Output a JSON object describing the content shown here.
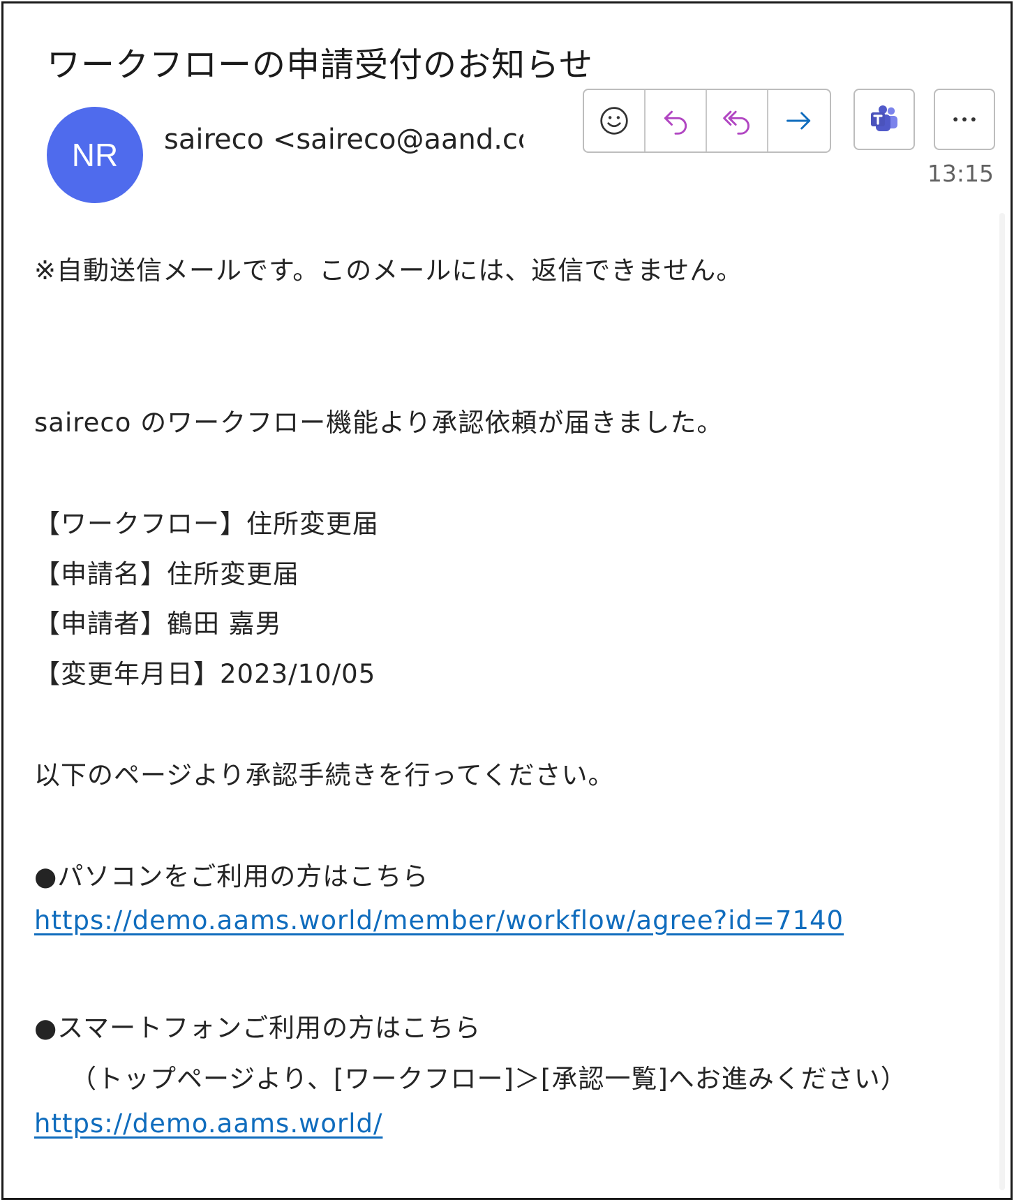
{
  "email": {
    "subject": "ワークフローの申請受付のお知らせ",
    "avatar_initials": "NR",
    "avatar_color": "#4f6bed",
    "sender": "saireco <saireco@aand.cc",
    "time": "13:15"
  },
  "toolbar": {
    "icons": [
      "emoji-icon",
      "reply-icon",
      "reply-all-icon",
      "forward-icon",
      "teams-icon",
      "more-icon"
    ]
  },
  "body": {
    "notice": "※自動送信メールです。このメールには、返信できません。",
    "intro": "saireco のワークフロー機能より承認依頼が届きました。",
    "workflow": "【ワークフロー】住所変更届",
    "request_name": "【申請名】住所変更届",
    "applicant": "【申請者】鶴田 嘉男",
    "change_date": "【変更年月日】2023/10/05",
    "instruction": "以下のページより承認手続きを行ってください。",
    "pc_heading": "●パソコンをご利用の方はこちら",
    "pc_link": "https://demo.aams.world/member/workflow/agree?id=7140",
    "sp_heading": "●スマートフォンご利用の方はこちら",
    "sp_note": "（トップページより、[ワークフロー]＞[承認一覧]へお進みください）",
    "sp_link": "https://demo.aams.world/"
  },
  "colors": {
    "link": "#0f6cbd",
    "reply_accent": "#b146c2",
    "forward_accent": "#0f6cbd",
    "teams": "#4b53bc"
  }
}
